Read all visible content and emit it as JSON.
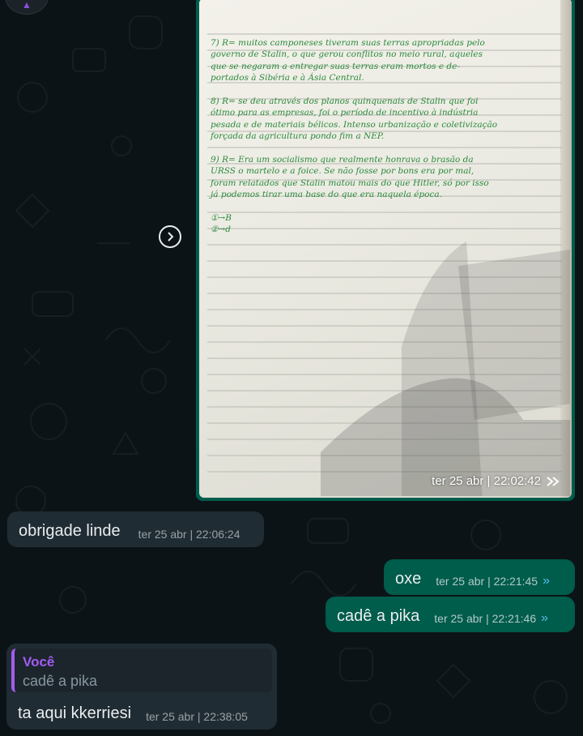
{
  "chat": {
    "top_avatar_icon": "group-avatar-icon",
    "forward_icon": "forward-icon",
    "image_message": {
      "timestamp": "ter 25 abr | 22:02:42",
      "status_icon": "double-check-icon",
      "notebook_lines": [
        "7) R= muitos camponeses tiveram suas terras apropriadas pelo",
        "governo de Stalin, o que gerou conflitos no meio rural, aqueles",
        "que se negaram a entregar suas terras eram mortos e de-",
        "portados à Sibéria e à Ásia Central.",
        "",
        "8) R= se deu através dos planos quinquenais de Stalin que foi",
        "ótimo para as empresas, foi o período de incentivo à indústria",
        "pesada e de materiais bélicos. Intenso urbanização e coletivização",
        "forçada da agricultura pondo fim a NEP.",
        "",
        "9) R= Era um socialismo que realmente honrava o brasão da",
        "URSS o martelo e a foice. Se não fosse por bons era por mal,",
        "foram relatados que Stalin matou mais do que Hitler, só por isso",
        "já podemos tirar uma base do que era naquela época.",
        "",
        "①→B",
        "②→d"
      ]
    },
    "messages": [
      {
        "direction": "in",
        "text": "obrigade linde",
        "time": "ter 25 abr | 22:06:24"
      },
      {
        "direction": "out",
        "text": "oxe",
        "time": "ter 25 abr | 22:21:45"
      },
      {
        "direction": "out",
        "text": "cadê a pika",
        "time": "ter 25 abr | 22:21:46"
      }
    ],
    "reply_message": {
      "quoted_author": "Você",
      "quoted_text": "cadê a pika",
      "text": "ta aqui kkerriesi",
      "time": "ter 25 abr | 22:38:05"
    },
    "colors": {
      "background": "#0c1317",
      "incoming_bubble": "#202c33",
      "outgoing_bubble": "#005c4b",
      "read_ticks": "#53bdeb",
      "quote_accent": "#a35cf3",
      "notebook_ink": "#2a8a3c"
    }
  }
}
